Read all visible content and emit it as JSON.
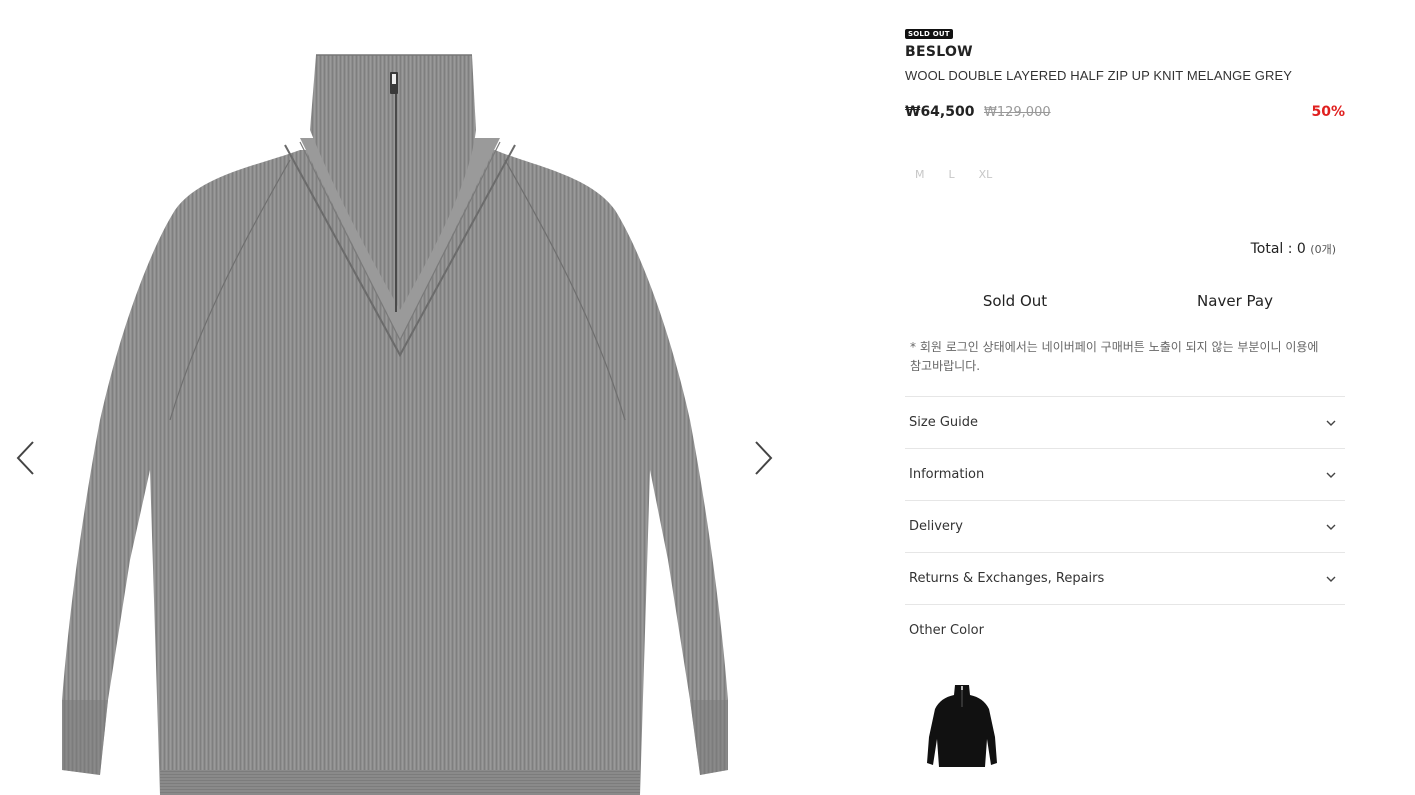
{
  "gallery": {
    "image_alt": "WOOL DOUBLE LAYERED HALF ZIP UP KNIT MELANGE GREY",
    "prev_icon": "chevron-left-icon",
    "next_icon": "chevron-right-icon"
  },
  "product": {
    "badge": "SOLD OUT",
    "brand": "BESLOW",
    "name": "WOOL DOUBLE LAYERED HALF ZIP UP KNIT MELANGE GREY",
    "sale_price": "₩64,500",
    "original_price": "₩129,000",
    "discount": "50%",
    "sizes": [
      "M",
      "L",
      "XL"
    ]
  },
  "total": {
    "label": "Total : 0",
    "count": "(0개)"
  },
  "buttons": {
    "sold_out": "Sold Out",
    "naver_pay": "Naver Pay"
  },
  "notice": "* 회원 로그인 상태에서는 네이버페이 구매버튼 노출이 되지 않는 부분이니 이용에 참고바랍니다.",
  "accordion": [
    {
      "label": "Size Guide",
      "icon": "chevron-down-icon"
    },
    {
      "label": "Information",
      "icon": "chevron-down-icon"
    },
    {
      "label": "Delivery",
      "icon": "chevron-down-icon"
    },
    {
      "label": "Returns & Exchanges, Repairs",
      "icon": "chevron-down-icon"
    }
  ],
  "other_color": {
    "label": "Other Color",
    "swatch_color": "#111111"
  },
  "colors": {
    "discount": "#e0201f",
    "sweater": "#8f8f8f"
  }
}
